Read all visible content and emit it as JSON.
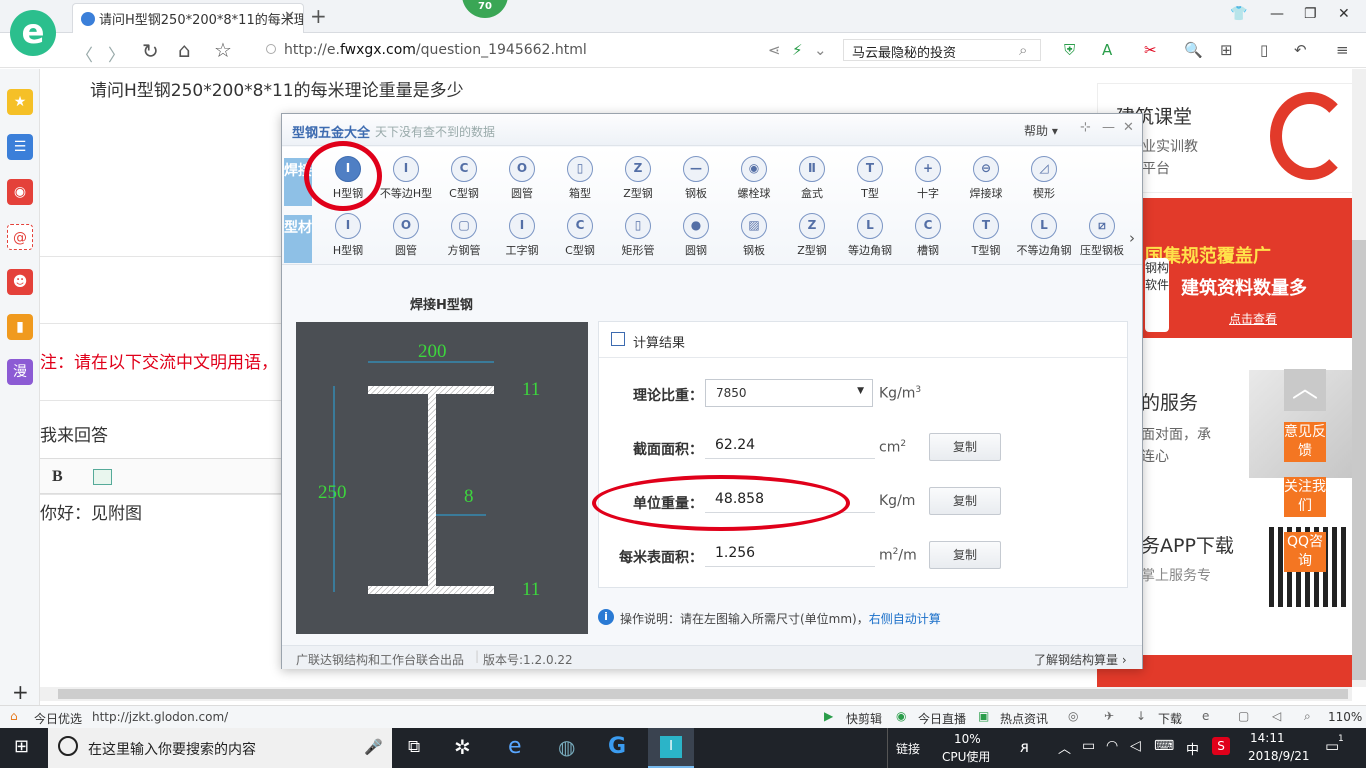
{
  "browser": {
    "tab_title": "请问H型钢250*200*8*11的每米理",
    "url_prefix": "http://e.",
    "url_domain": "fwxgx.com",
    "url_path": "/question_1945662.html",
    "search_text": "马云最隐秘的投资",
    "badge": "70"
  },
  "page": {
    "question": "请问H型钢250*200*8*11的每米理论重量是多少",
    "notice": "注：请在以下交流中文明用语，",
    "my_answer": "我来回答",
    "bold_btn": "B",
    "answer_text": "你好：见附图"
  },
  "ads": {
    "ad1_title": "建筑课堂",
    "ad1_line1": "行业实训教",
    "ad1_line2": "一平台",
    "ad2_line1": "国集规范覆盖广",
    "ad2_line2": "建筑资料数量多",
    "ad2_link": "点击查看",
    "ad2_badge": "钢构软件",
    "ad3_title": "的服务",
    "ad3_line1": "面对面，承",
    "ad3_line2": "连心",
    "ad4_title": "务APP下载",
    "ad4_line1": "掌上服务专"
  },
  "float_buttons": [
    "意见反馈",
    "关注我们",
    "QQ咨询"
  ],
  "dialog": {
    "title": "型钢五金大全",
    "subtitle": "天下没有查不到的数据",
    "help": "帮助",
    "row1_label": "焊接",
    "row2_label": "型材",
    "row1": [
      {
        "label": "H型钢",
        "glyph": "I",
        "selected": true
      },
      {
        "label": "不等边H型",
        "glyph": "I"
      },
      {
        "label": "C型钢",
        "glyph": "C"
      },
      {
        "label": "圆管",
        "glyph": "O"
      },
      {
        "label": "箱型",
        "glyph": "▯"
      },
      {
        "label": "Z型钢",
        "glyph": "Z"
      },
      {
        "label": "钢板",
        "glyph": "—"
      },
      {
        "label": "螺栓球",
        "glyph": "◉"
      },
      {
        "label": "盒式",
        "glyph": "Ⅱ"
      },
      {
        "label": "T型",
        "glyph": "T"
      },
      {
        "label": "十字",
        "glyph": "+"
      },
      {
        "label": "焊接球",
        "glyph": "⊖"
      },
      {
        "label": "楔形",
        "glyph": "◿"
      }
    ],
    "row2": [
      {
        "label": "H型钢",
        "glyph": "I"
      },
      {
        "label": "圆管",
        "glyph": "O"
      },
      {
        "label": "方钢管",
        "glyph": "▢"
      },
      {
        "label": "工字钢",
        "glyph": "I"
      },
      {
        "label": "C型钢",
        "glyph": "C"
      },
      {
        "label": "矩形管",
        "glyph": "▯"
      },
      {
        "label": "圆钢",
        "glyph": "●"
      },
      {
        "label": "钢板",
        "glyph": "▨"
      },
      {
        "label": "Z型钢",
        "glyph": "Z"
      },
      {
        "label": "等边角钢",
        "glyph": "L"
      },
      {
        "label": "槽钢",
        "glyph": "C"
      },
      {
        "label": "T型钢",
        "glyph": "T"
      },
      {
        "label": "不等边角钢",
        "glyph": "L"
      },
      {
        "label": "压型钢板",
        "glyph": "⧄"
      }
    ],
    "figure_title": "焊接H型钢",
    "dims": {
      "width": "200",
      "height": "250",
      "web": "8",
      "flange_top": "11",
      "flange_bottom": "11"
    },
    "results_header": "计算结果",
    "density_label": "理论比重：",
    "density_value": "7850",
    "density_unit": "Kg/m",
    "area_label": "截面面积：",
    "area_value": "62.24",
    "area_unit": "cm",
    "weight_label": "单位重量：",
    "weight_value": "48.858",
    "weight_unit": "Kg/m",
    "surface_label": "每米表面积：",
    "surface_value": "1.256",
    "surface_unit": "m",
    "surface_unit_suffix": "/m",
    "copy": "复制",
    "instructions": "操作说明：请在左图输入所需尺寸(单位mm)，",
    "instructions_link": "右侧自动计算",
    "footer_left": "广联达钢结构和工作台联合出品",
    "footer_version": "版本号:1.2.0.22",
    "footer_right": "了解钢结构算量"
  },
  "status": {
    "today": "今日优选",
    "link": "http://jzkt.glodon.com/",
    "kuaijian": "快剪辑",
    "live": "今日直播",
    "news": "热点资讯",
    "download": "下载",
    "zoom": "110%"
  },
  "taskbar": {
    "search": "在这里输入你要搜索的内容",
    "link": "链接",
    "cpu_pct": "10%",
    "cpu_label": "CPU使用",
    "ime": "中",
    "time": "14:11",
    "date": "2018/9/21",
    "notif": "1"
  },
  "colors": {
    "accent_red": "#e0001a",
    "float_orange": "#f47622",
    "dialog_blue": "#4f7fc4",
    "link_blue": "#1a6fc9"
  }
}
